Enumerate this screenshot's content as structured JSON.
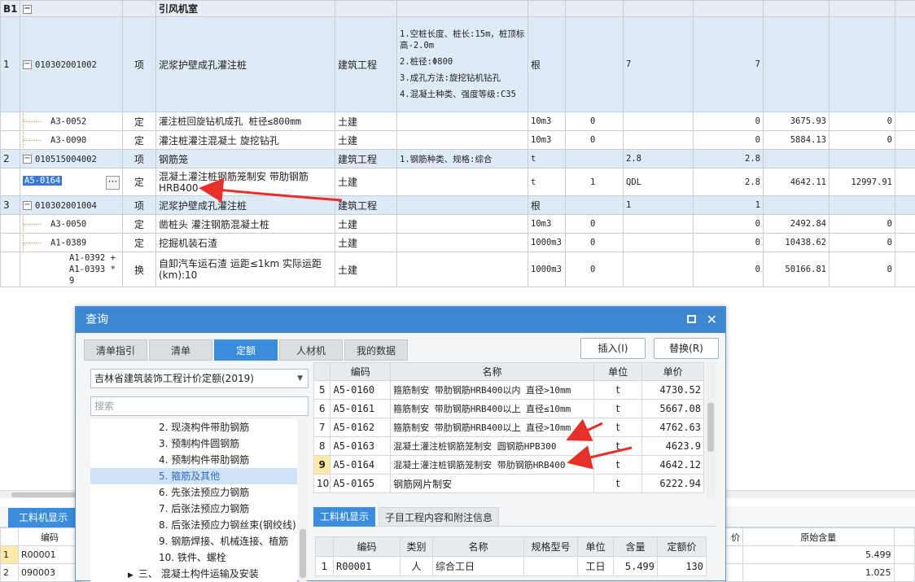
{
  "main": {
    "section_code": "B1",
    "section_title": "引风机室",
    "rows": [
      {
        "idx": "1",
        "code": "010302001002",
        "kind": "项",
        "name": "泥浆护壁成孔灌注桩",
        "major": "建筑工程",
        "features": [
          "1.空桩长度、桩长:15m，桩顶标高-2.0m",
          "2.桩径:Φ800",
          "3.成孔方法:旋挖钻机钻孔",
          "4.混凝土种类、强度等级:C35"
        ],
        "unit": "根",
        "c1": "",
        "c2": "7",
        "c3": "7",
        "c4": "",
        "c5": ""
      },
      {
        "idx": "",
        "code": "A3-0052",
        "kind": "定",
        "name": "灌注桩回旋钻机成孔 桩径≤800mm",
        "major": "土建",
        "unit": "10m3",
        "c1": "0",
        "c2": "",
        "c3": "0",
        "c4": "3675.93",
        "c5": "0"
      },
      {
        "idx": "",
        "code": "A3-0090",
        "kind": "定",
        "name": "灌注桩灌注混凝土 旋挖钻孔",
        "major": "土建",
        "unit": "10m3",
        "c1": "0",
        "c2": "",
        "c3": "0",
        "c4": "5884.13",
        "c5": "0"
      },
      {
        "idx": "2",
        "code": "010515004002",
        "kind": "项",
        "name": "钢筋笼",
        "major": "建筑工程",
        "features": [
          "1.钢筋种类、规格:综合"
        ],
        "unit": "t",
        "c1": "",
        "c2": "2.8",
        "c3": "2.8",
        "c4": "",
        "c5": ""
      },
      {
        "idx": "",
        "code": "A5-0164",
        "kind": "定",
        "name": "混凝土灌注桩钢筋笼制安 带肋钢筋HRB400",
        "major": "土建",
        "unit": "t",
        "c1": "1",
        "c2": "QDL",
        "c3": "2.8",
        "c4": "4642.11",
        "c5": "12997.91"
      },
      {
        "idx": "3",
        "code": "010302001004",
        "kind": "项",
        "name": "泥浆护壁成孔灌注桩",
        "major": "建筑工程",
        "unit": "根",
        "c1": "",
        "c2": "1",
        "c3": "1",
        "c4": "",
        "c5": ""
      },
      {
        "idx": "",
        "code": "A3-0050",
        "kind": "定",
        "name": "凿桩头 灌注钢筋混凝土桩",
        "major": "土建",
        "unit": "10m3",
        "c1": "0",
        "c2": "",
        "c3": "0",
        "c4": "2492.84",
        "c5": "0"
      },
      {
        "idx": "",
        "code": "A1-0389",
        "kind": "定",
        "name": "挖掘机装石渣",
        "major": "土建",
        "unit": "1000m3",
        "c1": "0",
        "c2": "",
        "c3": "0",
        "c4": "10438.62",
        "c5": "0"
      },
      {
        "idx": "",
        "code": "A1-0392 + A1-0393 * 9",
        "kind": "换",
        "name": "自卸汽车运石渣 运距≤1km  实际运距(km):10",
        "major": "土建",
        "unit": "1000m3",
        "c1": "0",
        "c2": "",
        "c3": "0",
        "c4": "50166.81",
        "c5": "0"
      }
    ]
  },
  "bottom_panel": {
    "tab_label": "工料机显示",
    "col_code": "编码",
    "rows": [
      {
        "idx": "1",
        "code": "R00001"
      },
      {
        "idx": "2",
        "code": "090003"
      }
    ],
    "right_col1": "价",
    "right_col2": "原始含量",
    "right_vals": [
      "5.499",
      "1.025"
    ]
  },
  "dialog": {
    "title": "查询",
    "tabs": [
      "清单指引",
      "清单",
      "定额",
      "人材机",
      "我的数据"
    ],
    "active_tab": "定额",
    "insert_label": "插入(I)",
    "replace_label": "替换(R)",
    "quota_book": "吉林省建筑装饰工程计价定额(2019)",
    "search_placeholder": "搜索",
    "tree": [
      "2. 现浇构件带肋钢筋",
      "3. 预制构件圆钢筋",
      "4. 预制构件带肋钢筋",
      "5. 箍筋及其他",
      "6. 先张法预应力钢筋",
      "7. 后张法预应力钢筋",
      "8. 后张法预应力钢丝束(钢绞线)",
      "9. 钢筋焊接、机械连接、植筋",
      "10. 铁件、螺栓",
      "三、 混凝土构件运输及安装"
    ],
    "quota_headers": [
      "编码",
      "名称",
      "单位",
      "单价"
    ],
    "quota_rows": [
      {
        "idx": "5",
        "code": "A5-0160",
        "name": "箍筋制安 带肋钢筋HRB400以内 直径>10mm",
        "unit": "t",
        "price": "4730.52"
      },
      {
        "idx": "6",
        "code": "A5-0161",
        "name": "箍筋制安 带肋钢筋HRB400以上 直径≤10mm",
        "unit": "t",
        "price": "5667.08"
      },
      {
        "idx": "7",
        "code": "A5-0162",
        "name": "箍筋制安 带肋钢筋HRB400以上 直径>10mm",
        "unit": "t",
        "price": "4762.63"
      },
      {
        "idx": "8",
        "code": "A5-0163",
        "name": "混凝土灌注桩钢筋笼制安 圆钢筋HPB300",
        "unit": "t",
        "price": "4623.9"
      },
      {
        "idx": "9",
        "code": "A5-0164",
        "name": "混凝土灌注桩钢筋笼制安 带肋钢筋HRB400",
        "unit": "t",
        "price": "4642.12"
      },
      {
        "idx": "10",
        "code": "A5-0165",
        "name": "钢筋网片制安",
        "unit": "t",
        "price": "6222.94"
      }
    ],
    "sub_tabs": [
      "工料机显示",
      "子目工程内容和附注信息"
    ],
    "res_headers": [
      "编码",
      "类别",
      "名称",
      "规格型号",
      "单位",
      "含量",
      "定额价"
    ],
    "res_rows": [
      {
        "idx": "1",
        "code": "R00001",
        "cat": "人",
        "name": "综合工日",
        "spec": "",
        "unit": "工日",
        "qty": "5.499",
        "price": "130"
      }
    ]
  },
  "colors": {
    "accent": "#3a8ddc",
    "group_row": "#dfeaf7",
    "arrow": "#e8302a"
  }
}
